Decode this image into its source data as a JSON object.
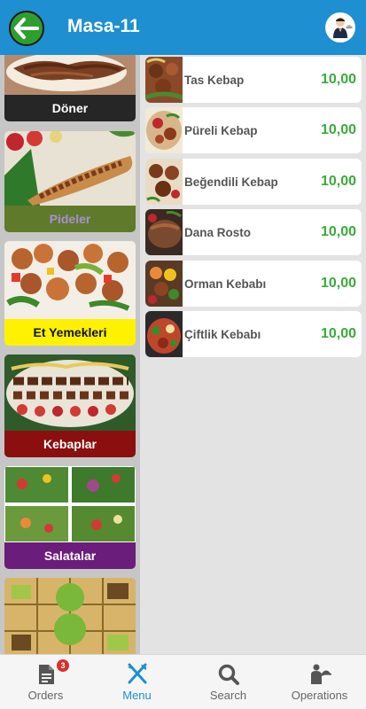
{
  "header": {
    "title": "Masa-11"
  },
  "categories": [
    {
      "label": "Döner",
      "label_bg": "#262626",
      "label_color": "#ffffff"
    },
    {
      "label": "Pideler",
      "label_bg": "#5f7a2a",
      "label_color": "#a98fd6"
    },
    {
      "label": "Et Yemekleri",
      "label_bg": "#fff200",
      "label_color": "#111111"
    },
    {
      "label": "Kebaplar",
      "label_bg": "#8b0f0f",
      "label_color": "#ffffff"
    },
    {
      "label": "Salatalar",
      "label_bg": "#6a1d7a",
      "label_color": "#ffffff"
    }
  ],
  "dishes": [
    {
      "name": "Tas Kebap",
      "price": "10,00"
    },
    {
      "name": "Püreli Kebap",
      "price": "10,00"
    },
    {
      "name": "Beğendili Kebap",
      "price": "10,00"
    },
    {
      "name": "Dana Rosto",
      "price": "10,00"
    },
    {
      "name": "Orman Kebabı",
      "price": "10,00"
    },
    {
      "name": "Çiftlik Kebabı",
      "price": "10,00"
    }
  ],
  "tabbar": {
    "orders": {
      "label": "Orders",
      "badge": "3",
      "icon": "document-icon"
    },
    "menu": {
      "label": "Menu",
      "icon": "fork-knife-icon",
      "active": true
    },
    "search": {
      "label": "Search",
      "icon": "search-icon"
    },
    "operations": {
      "label": "Operations",
      "icon": "waiter-icon"
    }
  },
  "colors": {
    "header_bg": "#1e8fd0",
    "price_green": "#3aaa3a",
    "back_button": "#2f9e2f",
    "active_tab": "#1e8fd0"
  }
}
